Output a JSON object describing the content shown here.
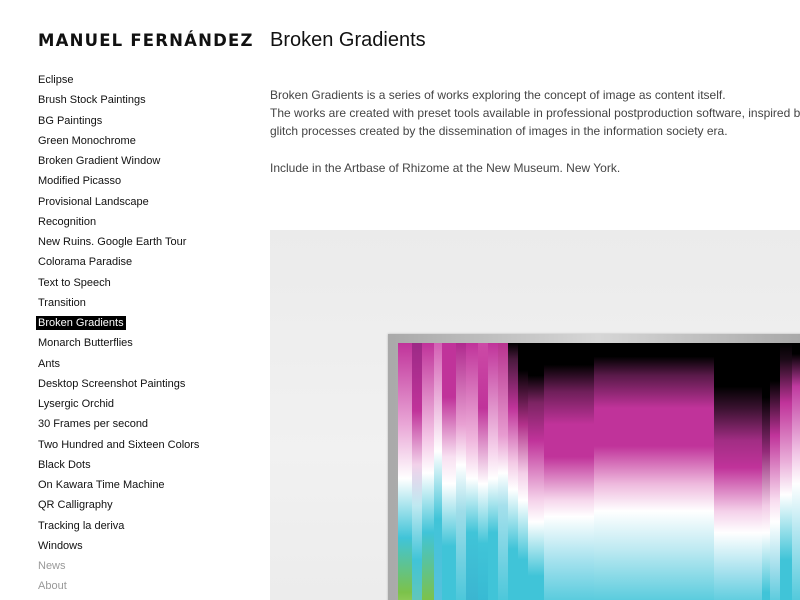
{
  "site": {
    "title": "MANUEL FERNÁNDEZ"
  },
  "nav": {
    "items": [
      {
        "label": "Eclipse",
        "state": "normal"
      },
      {
        "label": "Brush Stock Paintings",
        "state": "normal"
      },
      {
        "label": "BG Paintings",
        "state": "normal"
      },
      {
        "label": "Green Monochrome",
        "state": "normal"
      },
      {
        "label": "Broken Gradient Window",
        "state": "normal"
      },
      {
        "label": "Modified Picasso",
        "state": "normal"
      },
      {
        "label": "Provisional Landscape",
        "state": "normal"
      },
      {
        "label": "Recognition",
        "state": "normal"
      },
      {
        "label": "New Ruins. Google Earth Tour",
        "state": "normal"
      },
      {
        "label": "Colorama Paradise",
        "state": "normal"
      },
      {
        "label": "Text to Speech",
        "state": "normal"
      },
      {
        "label": "Transition",
        "state": "normal"
      },
      {
        "label": "Broken Gradients",
        "state": "active"
      },
      {
        "label": "Monarch Butterflies",
        "state": "normal"
      },
      {
        "label": "Ants",
        "state": "normal"
      },
      {
        "label": "Desktop Screenshot Paintings",
        "state": "normal"
      },
      {
        "label": "Lysergic Orchid",
        "state": "normal"
      },
      {
        "label": "30 Frames per second",
        "state": "normal"
      },
      {
        "label": "Two Hundred and Sixteen Colors",
        "state": "normal"
      },
      {
        "label": "Black Dots",
        "state": "normal"
      },
      {
        "label": "On Kawara Time Machine",
        "state": "normal"
      },
      {
        "label": "QR Calligraphy",
        "state": "normal"
      },
      {
        "label": "Tracking la deriva",
        "state": "normal"
      },
      {
        "label": "Windows",
        "state": "normal"
      },
      {
        "label": "News",
        "state": "muted"
      },
      {
        "label": "About",
        "state": "muted"
      }
    ]
  },
  "main": {
    "title": "Broken Gradients",
    "description": [
      "Broken Gradients is a series of works exploring the concept of image as content itself.",
      "The works are created with preset tools available in professional postproduction software, inspired by",
      "glitch processes created by the dissemination of images in the information society era."
    ],
    "note": "Include in the Artbase of Rhizome at the New Museum. New York."
  },
  "colors": {
    "active_bg": "#000000",
    "active_text": "#ffffff",
    "muted_text": "#999999",
    "magenta": "#c0339a",
    "cyan": "#40c4d8",
    "green": "#7cc24a"
  }
}
